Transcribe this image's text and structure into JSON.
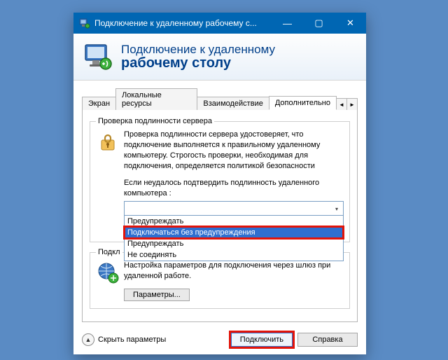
{
  "window": {
    "title": "Подключение к удаленному рабочему с...",
    "controls": {
      "min": "—",
      "max": "▢",
      "close": "✕"
    }
  },
  "header": {
    "line1": "Подключение к удаленному",
    "line2": "рабочему столу"
  },
  "tabs": {
    "items": [
      {
        "label": "Экран"
      },
      {
        "label": "Локальные ресурсы"
      },
      {
        "label": "Взаимодействие"
      },
      {
        "label": "Дополнительно"
      }
    ],
    "arrows": {
      "left": "◄",
      "right": "►"
    }
  },
  "group_auth": {
    "legend": "Проверка подлинности сервера",
    "text": "Проверка подлинности сервера удостоверяет, что подключение выполняется к правильному удаленному компьютеру. Строгость проверки, необходимая для подключения, определяется политикой безопасности",
    "sublabel": "Если неудалось подтвердить подлинность удаленного компьютера :",
    "dropdown": {
      "selected_index": 1,
      "options": [
        "Предупреждать",
        "Подключаться без предупреждения",
        "Предупреждать",
        "Не соединять"
      ]
    }
  },
  "group_gateway": {
    "legend": "Подкл",
    "text": "Настройка параметров для подключения через шлюз при удаленной работе.",
    "params_btn": "Параметры..."
  },
  "footer": {
    "collapse": "Скрыть параметры",
    "connect": "Подключить",
    "help": "Справка"
  }
}
